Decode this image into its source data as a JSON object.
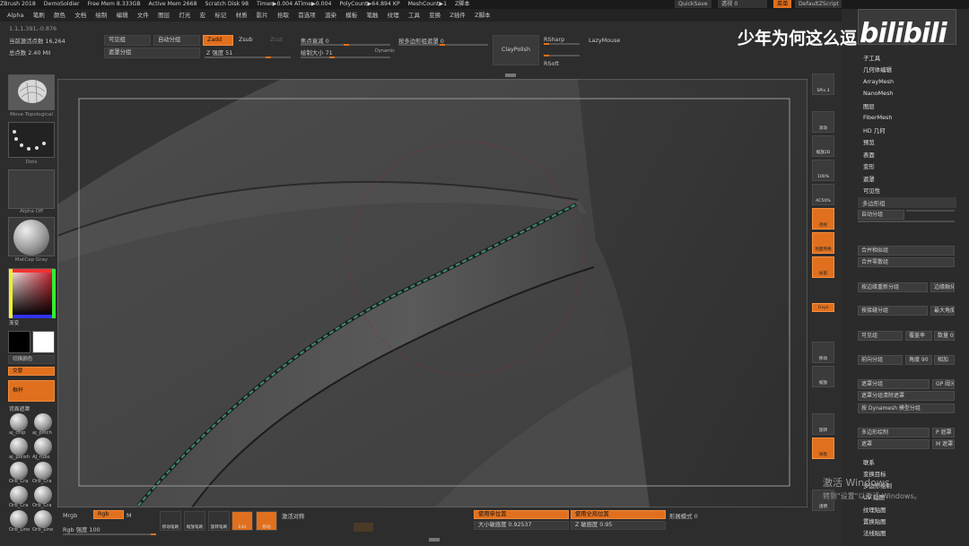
{
  "titlebar": {
    "app": "ZBrush 2018",
    "project": "DemoSoldier",
    "free_mem": "Free Mem 8.333GB",
    "active_mem": "Active Mem 2668",
    "scratch": "Scratch Disk 98",
    "timer": "Timer▶0.004 ATime▶0.004",
    "polycount": "PolyCount▶64.894 KP",
    "meshcount": "MeshCount▶1",
    "sequence": "Z脚本",
    "quicksave": "QuickSave",
    "transparency": "透视 0",
    "menu_btn": "菜单",
    "script": "DefaultZScript"
  },
  "menubar": [
    "Alpha",
    "笔刷",
    "颜色",
    "文档",
    "绘制",
    "编辑",
    "文件",
    "图层",
    "灯光",
    "宏",
    "标记",
    "材质",
    "影片",
    "拾取",
    "首选项",
    "渲染",
    "模板",
    "笔触",
    "纹理",
    "工具",
    "变换",
    "Z插件",
    "Z脚本"
  ],
  "topbar": {
    "coords": "1.1,1.391,-0.876",
    "active_points": "当前激活点数 16,264",
    "total_points": "总点数 2.40 Mil",
    "visible_group": "可见组",
    "auto_group": "自动分组",
    "mask_group": "遮罩分组",
    "zadd": "Zadd",
    "zsub": "Zsub",
    "zcut": "Zcut",
    "z_intensity": "Z 强度 51",
    "focal_shift": "焦点衰减 0",
    "draw_size": "绘制大小 71",
    "dynamic": "Dynamic",
    "poly_mask": "按多边形组遮罩 0",
    "claypolish": "ClayPolish",
    "rsharp": "RSharp",
    "rsoft": "RSoft",
    "lazymouse": "LazyMouse"
  },
  "leftpanel": {
    "brush_label": "Move Topological",
    "stroke_label": "Dots",
    "alpha_label": "Alpha Off",
    "material_label": "MatCap Gray",
    "gradient": "渐变",
    "switch_color": "切换颜色",
    "alternate": "交替",
    "sidebar_btn": "框杆",
    "back_mask": "背面遮罩",
    "brushes": [
      "aj_chip",
      "aj_pinch",
      "aj_polish",
      "AJ_rubs",
      "Orb_Cra",
      "Orb_Cra",
      "Orb_Cra",
      "Orb_Cra",
      "Orb_Line",
      "Orb_Line"
    ]
  },
  "rightbar": [
    {
      "label": "SPix 3",
      "orange": false
    },
    {
      "label": "滚动",
      "orange": false
    },
    {
      "label": "缩放2D",
      "orange": false
    },
    {
      "label": "100%",
      "orange": false
    },
    {
      "label": "AC50%",
      "orange": false
    },
    {
      "label": "透视",
      "orange": true
    },
    {
      "label": "地面网格",
      "orange": true
    },
    {
      "label": "局部",
      "orange": true
    },
    {
      "label": "Gxyz",
      "orange": true
    },
    {
      "label": "移动",
      "orange": false
    },
    {
      "label": "缩放",
      "orange": false
    },
    {
      "label": "旋转",
      "orange": false
    },
    {
      "label": "线框",
      "orange": true
    },
    {
      "label": "透明",
      "orange": false
    }
  ],
  "rightpanel": {
    "top_items": [
      "子工具",
      "几何体编辑",
      "ArrayMesh",
      "NanoMesh",
      "图层",
      "FiberMesh",
      "HD 几何",
      "预览",
      "表面",
      "变形",
      "遮罩",
      "可见性"
    ],
    "polygroups": "多边形组",
    "auto_groups": "自动分组",
    "merge_similar": "合并相似组",
    "merge_stray": "合并零散组",
    "group_by_normals": "按边缘重新分组",
    "edge_label": "边缘融化",
    "group_by_uv": "按接缝分组",
    "max_angle": "最大角度",
    "visible": "可见组",
    "coverage": "覆盖率",
    "count": "数量 0.1",
    "front_group": "前向分组",
    "angle": "角度 90",
    "add": "相加",
    "mask_group": "遮罩分组",
    "gp_label": "GP 阈光",
    "mask_clear": "遮罩分组清除遮罩",
    "dynamesh": "按 Dynamesh 模型分组",
    "poly_paint": "多边形绘制",
    "mask": "遮罩",
    "p_label": "P 遮罩",
    "m_label": "M 遮罩",
    "bottom_items": [
      "联系",
      "变换目标",
      "多边形绘制",
      "UV 贴图",
      "纹理贴图",
      "置换贴图",
      "法线贴图"
    ]
  },
  "bottombar": {
    "mrgb": "Mrgb",
    "rgb": "Rgb",
    "m": "M",
    "rgb_intensity": "Rgb 强度 100",
    "icons": [
      "移动笔刷",
      "缩放笔刷",
      "旋转笔刷",
      "Edit",
      "移动"
    ],
    "symmetry": "激活对称",
    "use_pos": "使用单位置",
    "use_global": "使用全局位置",
    "size_sense": "大小敏感度 0.92537",
    "z_sense": "Z 敏感度 0.95",
    "tilt_mode": "形展模式 0"
  },
  "overlay": {
    "watermark": "少年为何这么逗",
    "bili": "bilibili",
    "win_activate": "激活 Windows",
    "win_settings": "转到\"设置\"以激活 Windows。"
  },
  "colors": {
    "accent": "#e0701e",
    "panel": "#2d2d2d",
    "viewport": "#3a3a3a",
    "seam": "#3a8f78"
  }
}
